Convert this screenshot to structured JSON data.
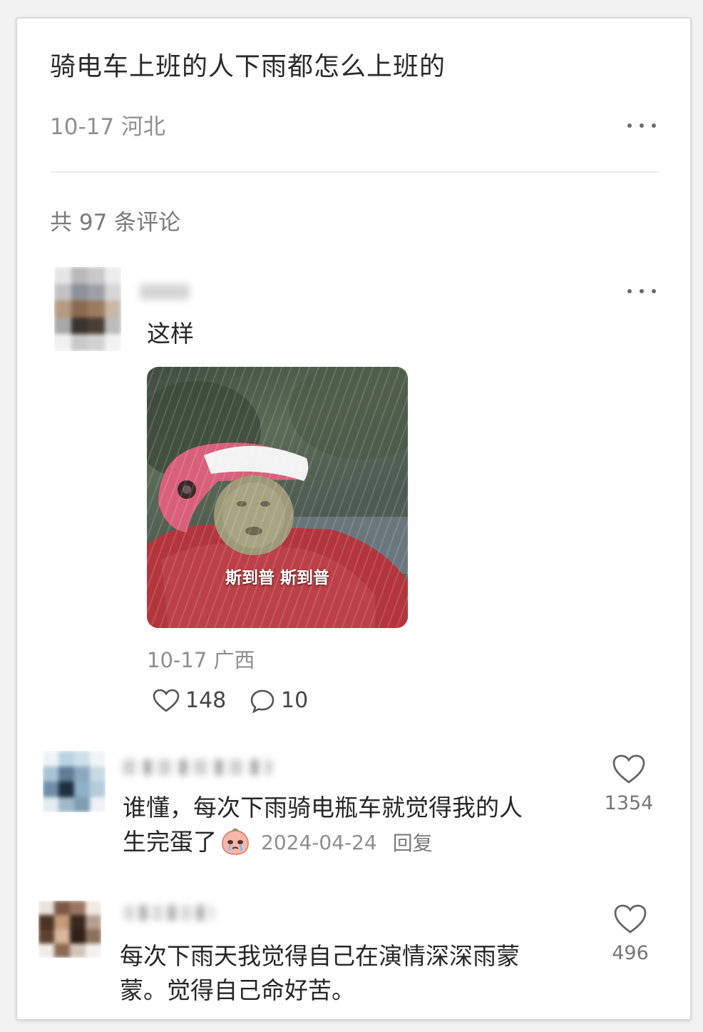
{
  "post": {
    "title": "骑电车上班的人下雨都怎么上班的",
    "meta": "10-17 河北"
  },
  "comments_header": "共 97 条评论",
  "first_comment": {
    "text": "这样",
    "image_caption": "斯到普 斯到普",
    "meta": "10-17 广西",
    "likes": "148",
    "replies": "10"
  },
  "replies": [
    {
      "text_line1": "谁懂，每次下雨骑电瓶车就觉得我的人",
      "text_line2": "生完蛋了",
      "date": "2024-04-24",
      "reply_label": "回复",
      "likes": "1354"
    },
    {
      "text_line1": "每次下雨天我觉得自己在演情深深雨蒙",
      "text_line2": "蒙。觉得自己命好苦。",
      "likes": "496"
    }
  ],
  "colors": {
    "text": "#262626",
    "muted": "#8e8e8e",
    "helmet": "#d9607a",
    "raincoat": "#b3363d"
  }
}
